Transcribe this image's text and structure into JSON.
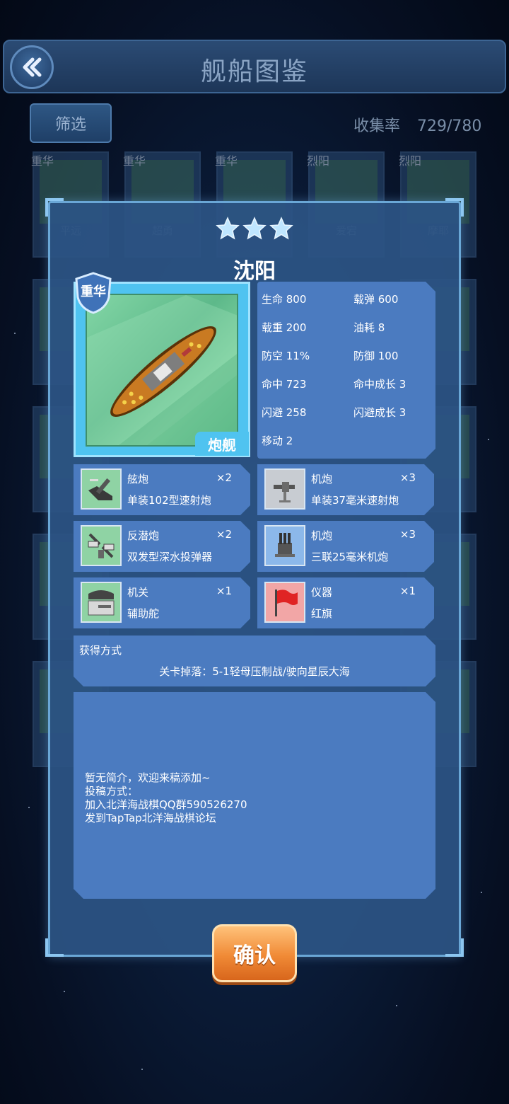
{
  "header": {
    "title": "舰船图鉴"
  },
  "toolbar": {
    "filter_label": "筛选",
    "collect_label": "收集率",
    "collect_count": "729/780"
  },
  "background_cards": [
    {
      "tag": "重华",
      "name": "平远"
    },
    {
      "tag": "重华",
      "name": "超勇"
    },
    {
      "tag": "重华",
      "name": ""
    },
    {
      "tag": "烈阳",
      "name": "爱宕"
    },
    {
      "tag": "烈阳",
      "name": "摩耶"
    }
  ],
  "ship": {
    "name": "沈阳",
    "stars": 3,
    "faction": "重华",
    "type": "炮舰",
    "stats": [
      {
        "label": "生命 800"
      },
      {
        "label": "载弹 600"
      },
      {
        "label": "载重 200"
      },
      {
        "label": "油耗 8"
      },
      {
        "label": "防空 11%"
      },
      {
        "label": "防御 100"
      },
      {
        "label": "命中 723"
      },
      {
        "label": "命中成长 3"
      },
      {
        "label": "闪避 258"
      },
      {
        "label": "闪避成长 3"
      },
      {
        "label": "移动 2"
      }
    ],
    "equipment": [
      {
        "type": "舷炮",
        "qty": "×2",
        "name": "单装102型速射炮",
        "icon": "deck-gun-icon"
      },
      {
        "type": "机炮",
        "qty": "×3",
        "name": "单装37毫米速射炮",
        "icon": "autocannon-icon"
      },
      {
        "type": "反潜炮",
        "qty": "×2",
        "name": "双发型深水投弹器",
        "icon": "depth-charge-icon"
      },
      {
        "type": "机炮",
        "qty": "×3",
        "name": "三联25毫米机炮",
        "icon": "triple-gun-icon"
      },
      {
        "type": "机关",
        "qty": "×1",
        "name": "辅助舵",
        "icon": "rudder-icon"
      },
      {
        "type": "仪器",
        "qty": "×1",
        "name": "红旗",
        "icon": "red-flag-icon"
      }
    ],
    "acquire": {
      "title": "获得方式",
      "line": "关卡掉落：5-1轻母压制战/驶向星辰大海"
    },
    "description": [
      "暂无简介，欢迎来稿添加~",
      "投稿方式：",
      "加入北洋海战棋QQ群590526270",
      "发到TapTap北洋海战棋论坛"
    ]
  },
  "confirm_label": "确认",
  "colors": {
    "panel": "#4b7bc0",
    "accent": "#4fc3f0",
    "confirm": "#f08a36"
  }
}
